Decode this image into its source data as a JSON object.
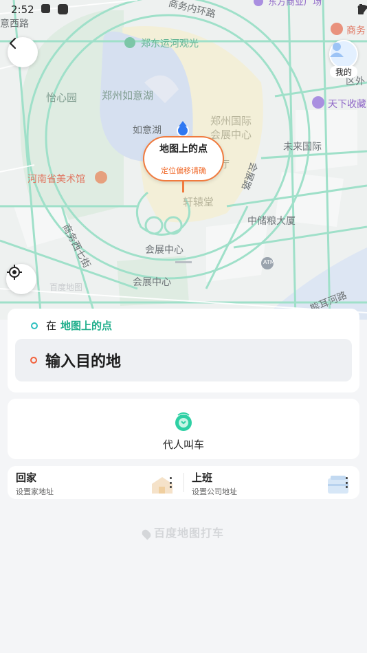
{
  "status_bar": {
    "time": "2:52"
  },
  "map": {
    "labels": {
      "road_top": "商务内环路",
      "road_left": "意西路",
      "canal": "郑东运河观光",
      "park": "怡心园",
      "lake_name": "郑州如意湖",
      "lake_short": "如意湖",
      "expo": "郑州国际\n会展中心",
      "future": "未来国际",
      "museum": "河南省美术馆",
      "hall_partial": "厅",
      "xuanyuan": "轩辕堂",
      "zhongchu": "中储粮大厦",
      "expo_station_1": "会展中心",
      "expo_station_2": "会展中心",
      "road_seven": "商务西七街",
      "road_expo": "会展路",
      "road_xiong": "熊耳河路",
      "biz_top_right": "商务",
      "area_right": "区外",
      "tianxia": "天下收藏",
      "dongfang": "东方商业广场",
      "watermark": "百度地图",
      "atm": "ATM"
    },
    "pin_bubble": {
      "title": "地图上的点",
      "subtitle": "定位偏移请确"
    },
    "me_label": "我的"
  },
  "route": {
    "from_prefix": "在",
    "from_value": "地图上的点",
    "destination_placeholder": "输入目的地"
  },
  "proxy_call": {
    "label": "代人叫车"
  },
  "addresses": {
    "home": {
      "title": "回家",
      "subtitle": "设置家地址"
    },
    "work": {
      "title": "上班",
      "subtitle": "设置公司地址"
    }
  },
  "brand": "百度地图打车",
  "colors": {
    "accent_green": "#1fae8b",
    "dest_red": "#f2603a",
    "bubble_orange": "#f07b3f"
  }
}
